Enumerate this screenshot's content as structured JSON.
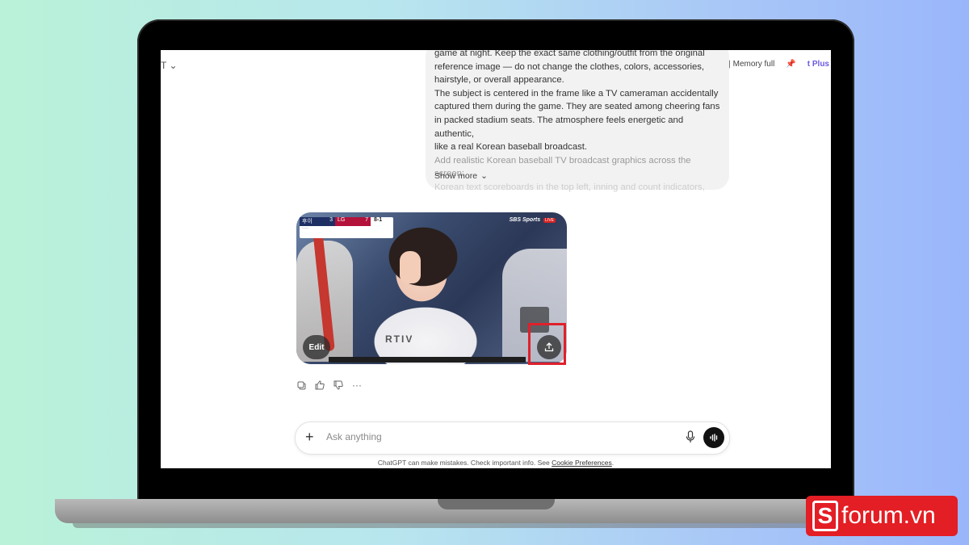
{
  "header": {
    "model_switcher": "T",
    "memory_label": "Memory full",
    "plus_label": "t Plus"
  },
  "user_message": {
    "lines": [
      "game at night. Keep the exact same clothing/outfit from the original",
      "reference image — do not change the clothes, colors, accessories,",
      "hairstyle, or overall appearance.",
      "The subject is centered in the frame like a TV cameraman accidentally",
      "captured them during the game. They are seated among cheering fans",
      "in packed stadium seats. The atmosphere feels energetic and authentic,",
      "like a real Korean baseball broadcast.",
      "Add realistic Korean baseball TV broadcast graphics across the screen:",
      "Korean text scoreboards in the top left, inning and count indicators,"
    ],
    "show_more": "Show more"
  },
  "image": {
    "scoreboard": {
      "team1": "후이",
      "score1": "3",
      "team2": "LG",
      "score2": "7",
      "inning": "8-1"
    },
    "channel": {
      "name": "SBS Sports",
      "live": "LIVE"
    },
    "jersey_text": "RTIV",
    "edit_label": "Edit"
  },
  "composer": {
    "placeholder": "Ask anything"
  },
  "footer": {
    "disclaimer": "ChatGPT can make mistakes. Check important info. See",
    "link": "Cookie Preferences",
    "period": "."
  },
  "watermark": {
    "text": "forum.vn",
    "letter": "S"
  },
  "colors": {
    "highlight": "#e0202b",
    "brand": "#e31e24",
    "plus": "#6a5ae0"
  }
}
